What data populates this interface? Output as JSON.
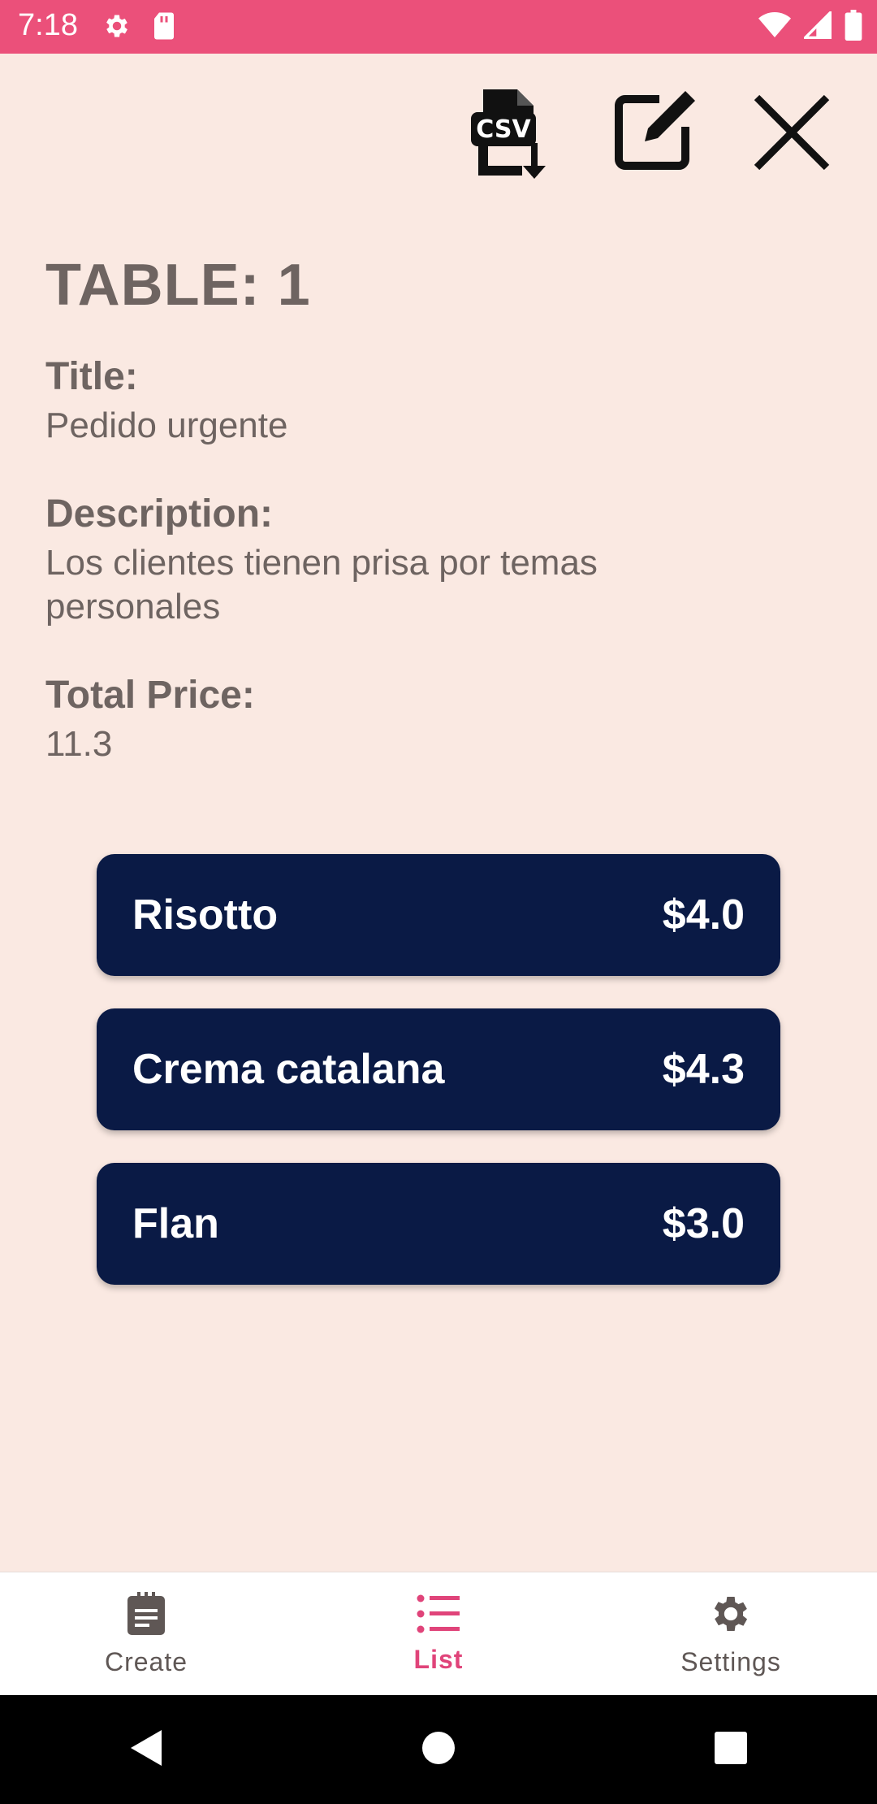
{
  "status_bar": {
    "time": "7:18",
    "background_color": "#EB507A",
    "icons": [
      "gear-icon",
      "sd-card-icon",
      "wifi-icon",
      "signal-icon",
      "battery-icon"
    ]
  },
  "toolbar": {
    "csv_icon_text": "CSV",
    "actions": [
      "csv-download-icon",
      "edit-icon",
      "close-icon"
    ]
  },
  "table": {
    "heading": "TABLE: 1",
    "title_label": "Title:",
    "title_value": "Pedido urgente",
    "description_label": "Description:",
    "description_value": "Los clientes tienen prisa por temas personales",
    "total_price_label": "Total Price:",
    "total_price_value": "11.3"
  },
  "items": [
    {
      "name": "Risotto",
      "price": "$4.0"
    },
    {
      "name": "Crema catalana",
      "price": "$4.3"
    },
    {
      "name": "Flan",
      "price": "$3.0"
    }
  ],
  "bottom_nav": {
    "active": "List",
    "active_color": "#E0447A",
    "items": [
      {
        "label": "Create",
        "icon": "clipboard-icon"
      },
      {
        "label": "List",
        "icon": "list-icon"
      },
      {
        "label": "Settings",
        "icon": "gear-icon"
      }
    ]
  },
  "colors": {
    "background": "#FAE9E2",
    "card": "#0A1A45",
    "text_muted": "#6E6461"
  }
}
